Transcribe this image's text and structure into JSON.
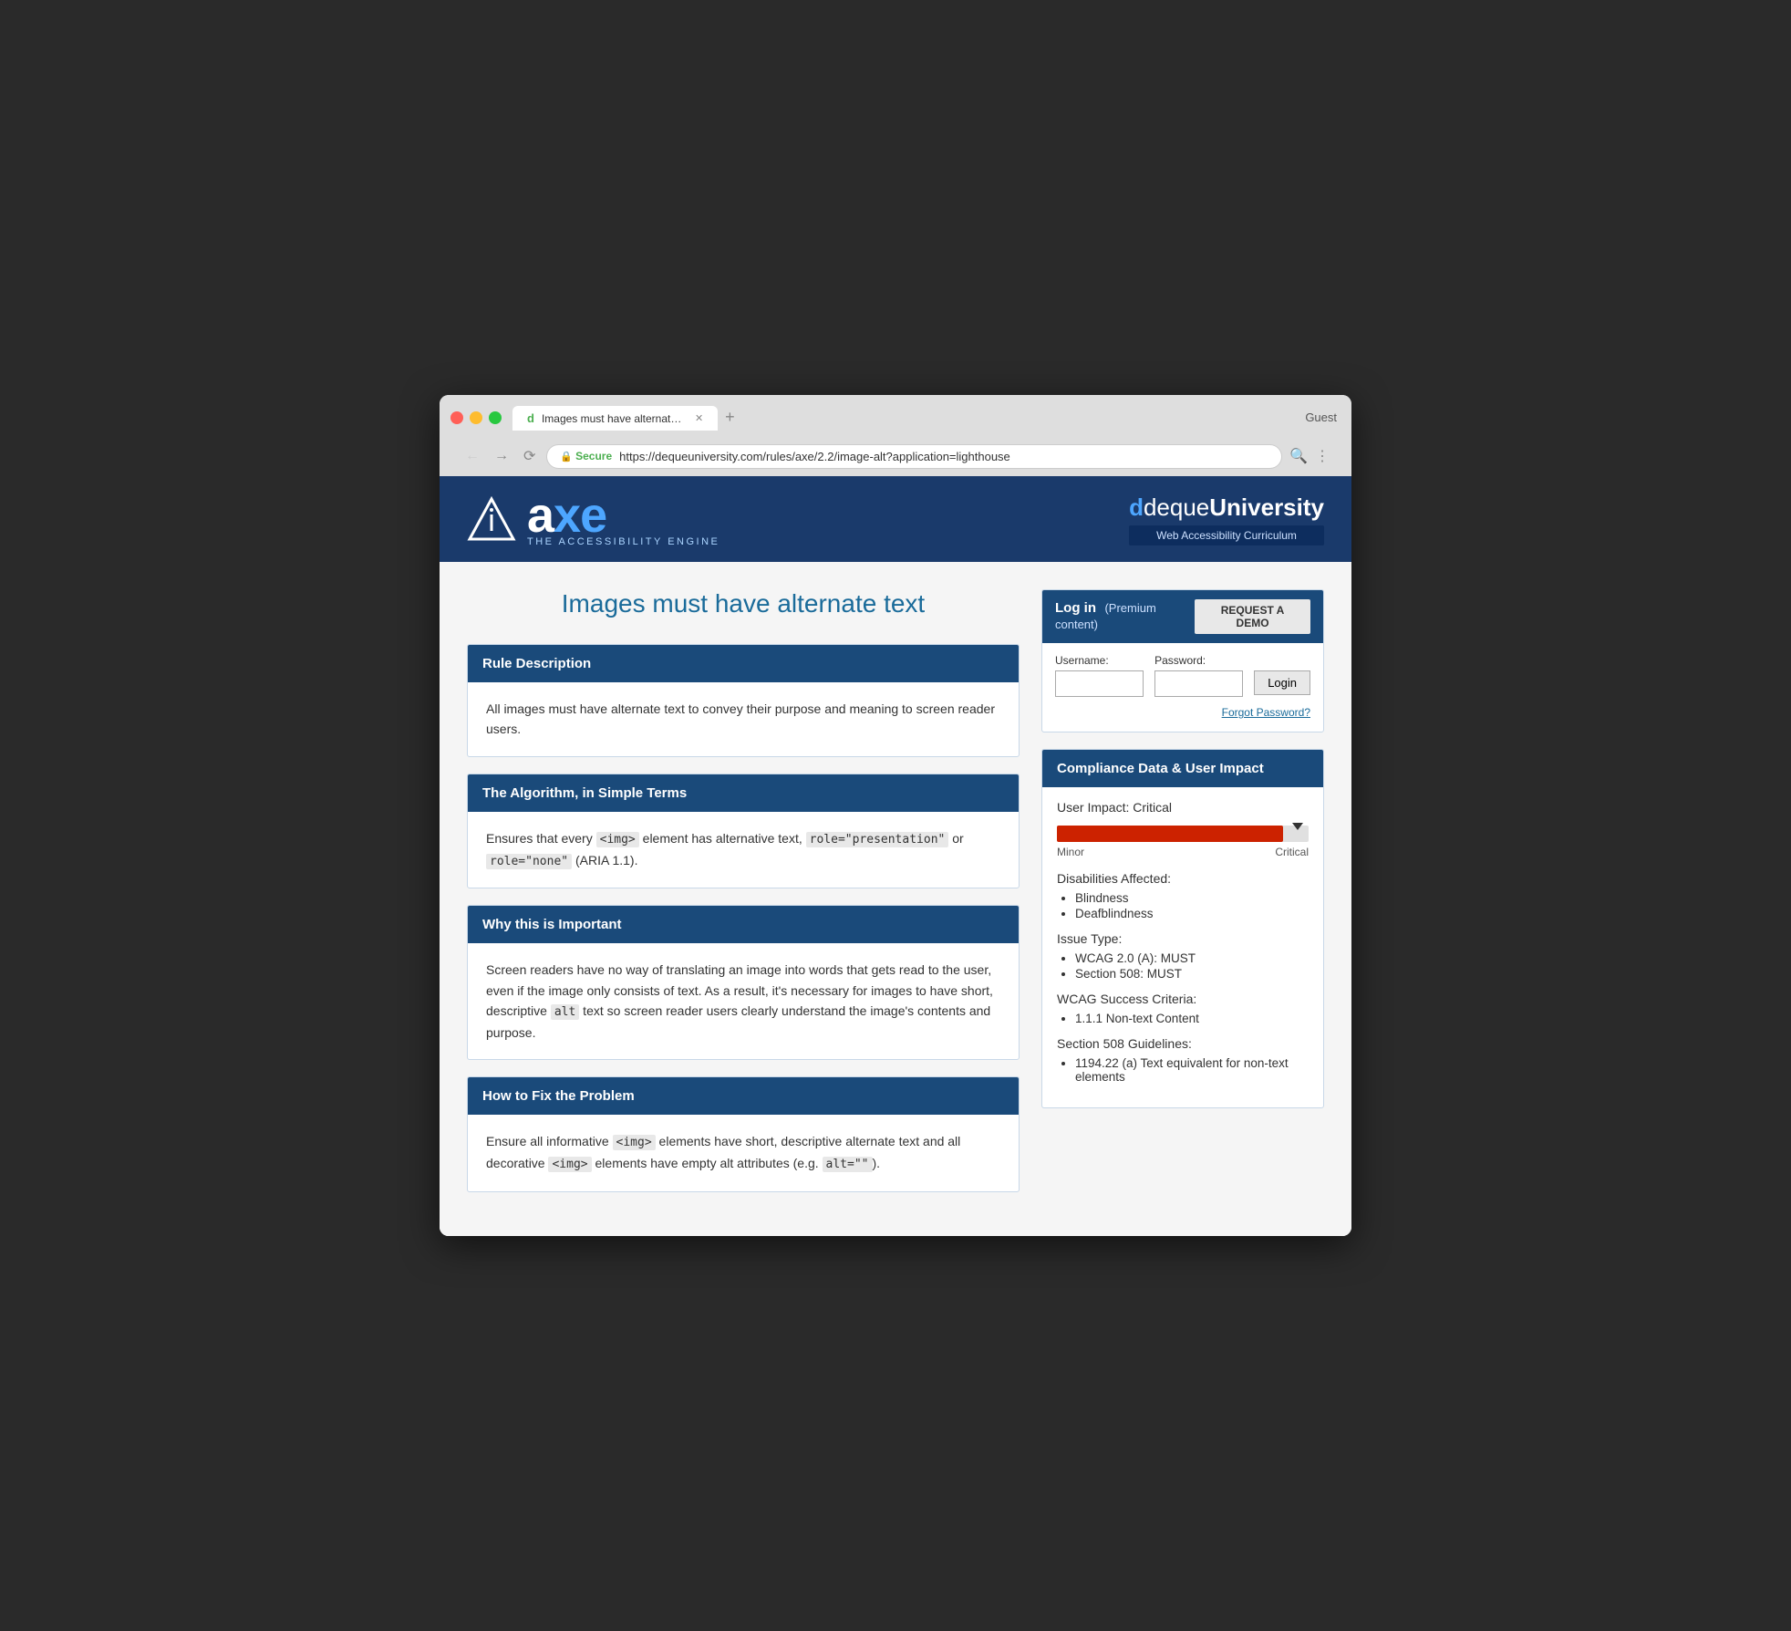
{
  "browser": {
    "tab_title": "Images must have alternate te…",
    "tab_favicon": "d",
    "secure_label": "Secure",
    "url": "https://dequeuniversity.com/rules/axe/2.2/image-alt?application=lighthouse",
    "guest_label": "Guest",
    "new_tab_label": "+"
  },
  "header": {
    "axe_title_normal": "a",
    "axe_title_colored": "xe",
    "subtitle": "THE ACCESSIBILITY ENGINE",
    "deque_prefix": "deque",
    "deque_suffix": "University",
    "curriculum": "Web Accessibility Curriculum"
  },
  "login": {
    "title": "Log in",
    "subtitle": "(Premium content)",
    "request_demo": "REQUEST A DEMO",
    "username_label": "Username:",
    "password_label": "Password:",
    "login_btn": "Login",
    "forgot_password": "Forgot Password?"
  },
  "page_title": "Images must have alternate text",
  "sections": [
    {
      "title": "Rule Description",
      "body": "All images must have alternate text to convey their purpose and meaning to screen reader users."
    },
    {
      "title": "The Algorithm, in Simple Terms",
      "body_html": true,
      "body": "Ensures that every <img> element has alternative text, role=\"presentation\" or role=\"none\" (ARIA 1.1)."
    },
    {
      "title": "Why this is Important",
      "body_html": true,
      "body": "Screen readers have no way of translating an image into words that gets read to the user, even if the image only consists of text. As a result, it's necessary for images to have short, descriptive alt text so screen reader users clearly understand the image's contents and purpose."
    },
    {
      "title": "How to Fix the Problem",
      "body_html": true,
      "body": "Ensure all informative <img> elements have short, descriptive alternate text and all decorative <img> elements have empty alt attributes (e.g. alt=\"\")."
    }
  ],
  "compliance": {
    "title": "Compliance Data & User Impact",
    "user_impact_label": "User Impact:",
    "user_impact_value": "Critical",
    "impact_bar_minor": "Minor",
    "impact_bar_critical": "Critical",
    "disabilities_title": "Disabilities Affected:",
    "disabilities": [
      "Blindness",
      "Deafblindness"
    ],
    "issue_type_title": "Issue Type:",
    "issue_types": [
      "WCAG 2.0 (A): MUST",
      "Section 508: MUST"
    ],
    "wcag_title": "WCAG Success Criteria:",
    "wcag_items": [
      "1.1.1 Non-text Content"
    ],
    "section508_title": "Section 508 Guidelines:",
    "section508_items": [
      "1194.22 (a) Text equivalent for non-text elements"
    ]
  }
}
